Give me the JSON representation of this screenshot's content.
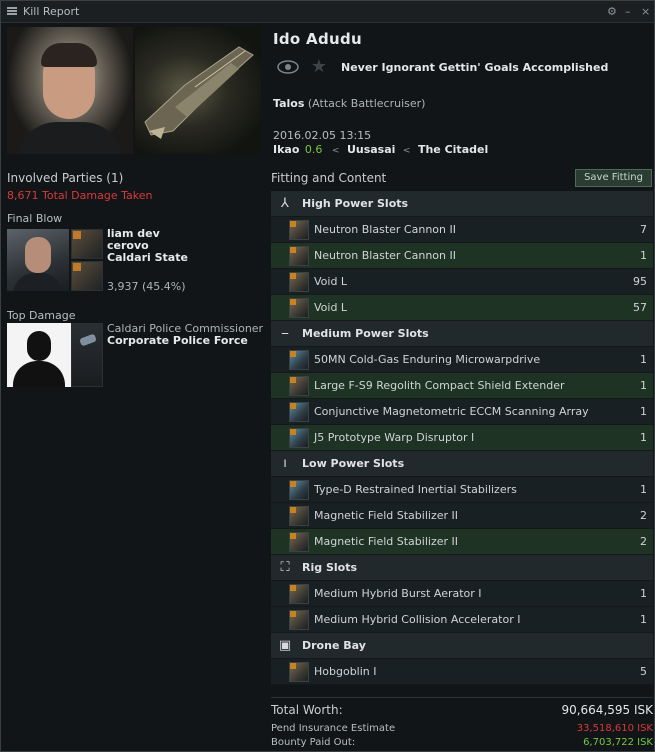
{
  "window": {
    "title": "Kill Report",
    "controls": [
      "⚙",
      "–",
      "×"
    ]
  },
  "victim": {
    "name": "Ido Adudu",
    "corporation": "Never Ignorant Gettin' Goals Accomplished",
    "ship_name": "Talos",
    "ship_class": "(Attack Battlecruiser)",
    "datetime": "2016.02.05 13:15",
    "system": "Ikao",
    "security": "0.6",
    "constellation": "Uusasai",
    "region": "The Citadel"
  },
  "involved": {
    "title": "Involved Parties (1)",
    "total_damage": "8,671 Total Damage Taken",
    "final_blow_label": "Final Blow",
    "final_blow": {
      "pilot": "liam dev",
      "corp": "cerovo",
      "faction": "Caldari State",
      "damage": "3,937 (45.4%)"
    },
    "top_damage_label": "Top Damage",
    "top_damage": {
      "name": "Caldari Police Commissioner",
      "corp": "Corporate Police Force"
    }
  },
  "fitting": {
    "title": "Fitting and Content",
    "save_label": "Save Fitting",
    "sections": [
      {
        "label": "High Power Slots",
        "icon": "high-slot-icon",
        "glyph": "⅄",
        "items": [
          {
            "name": "Neutron Blaster Cannon II",
            "qty": "7",
            "icon": "blaster-icon",
            "alt": false
          },
          {
            "name": "Neutron Blaster Cannon II",
            "qty": "1",
            "icon": "blaster-icon",
            "alt": true
          },
          {
            "name": "Void L",
            "qty": "95",
            "icon": "ammo-icon",
            "alt": false
          },
          {
            "name": "Void L",
            "qty": "57",
            "icon": "ammo-icon",
            "alt": true
          }
        ]
      },
      {
        "label": "Medium Power Slots",
        "icon": "mid-slot-icon",
        "glyph": "⎯",
        "items": [
          {
            "name": "50MN Cold-Gas Enduring Microwarpdrive",
            "qty": "1",
            "icon": "microwarpdrive-icon",
            "alt": false
          },
          {
            "name": "Large F-S9 Regolith Compact Shield Extender",
            "qty": "1",
            "icon": "shield-extender-icon",
            "alt": true
          },
          {
            "name": "Conjunctive Magnetometric ECCM Scanning Array",
            "qty": "1",
            "icon": "eccm-icon",
            "alt": false
          },
          {
            "name": "J5 Prototype Warp Disruptor I",
            "qty": "1",
            "icon": "warp-disruptor-icon",
            "alt": true
          }
        ]
      },
      {
        "label": "Low Power Slots",
        "icon": "low-slot-icon",
        "glyph": "ı",
        "items": [
          {
            "name": "Type-D Restrained Inertial Stabilizers",
            "qty": "1",
            "icon": "inertial-stabilizer-icon",
            "alt": false
          },
          {
            "name": "Magnetic Field Stabilizer II",
            "qty": "2",
            "icon": "mag-stab-icon",
            "alt": false
          },
          {
            "name": "Magnetic Field Stabilizer II",
            "qty": "2",
            "icon": "mag-stab-icon",
            "alt": true
          }
        ]
      },
      {
        "label": "Rig Slots",
        "icon": "rig-slot-icon",
        "glyph": "⛶",
        "items": [
          {
            "name": "Medium Hybrid Burst Aerator I",
            "qty": "1",
            "icon": "rig-icon",
            "alt": false
          },
          {
            "name": "Medium Hybrid Collision Accelerator I",
            "qty": "1",
            "icon": "rig-icon",
            "alt": false
          }
        ]
      },
      {
        "label": "Drone Bay",
        "icon": "drone-bay-icon",
        "glyph": "▣",
        "items": [
          {
            "name": "Hobgoblin I",
            "qty": "5",
            "icon": "drone-icon",
            "alt": false
          }
        ]
      }
    ]
  },
  "totals": {
    "total_worth_label": "Total Worth:",
    "total_worth": "90,664,595 ISK",
    "insurance_label": "Pend Insurance Estimate",
    "insurance_value": "33,518,610 ISK",
    "bounty_label": "Bounty Paid Out:",
    "bounty_value": "6,703,722 ISK"
  },
  "colors": {
    "damage_red": "#d63a3a",
    "security_green": "#76c83f",
    "row_alt_green": "#1f3325"
  }
}
